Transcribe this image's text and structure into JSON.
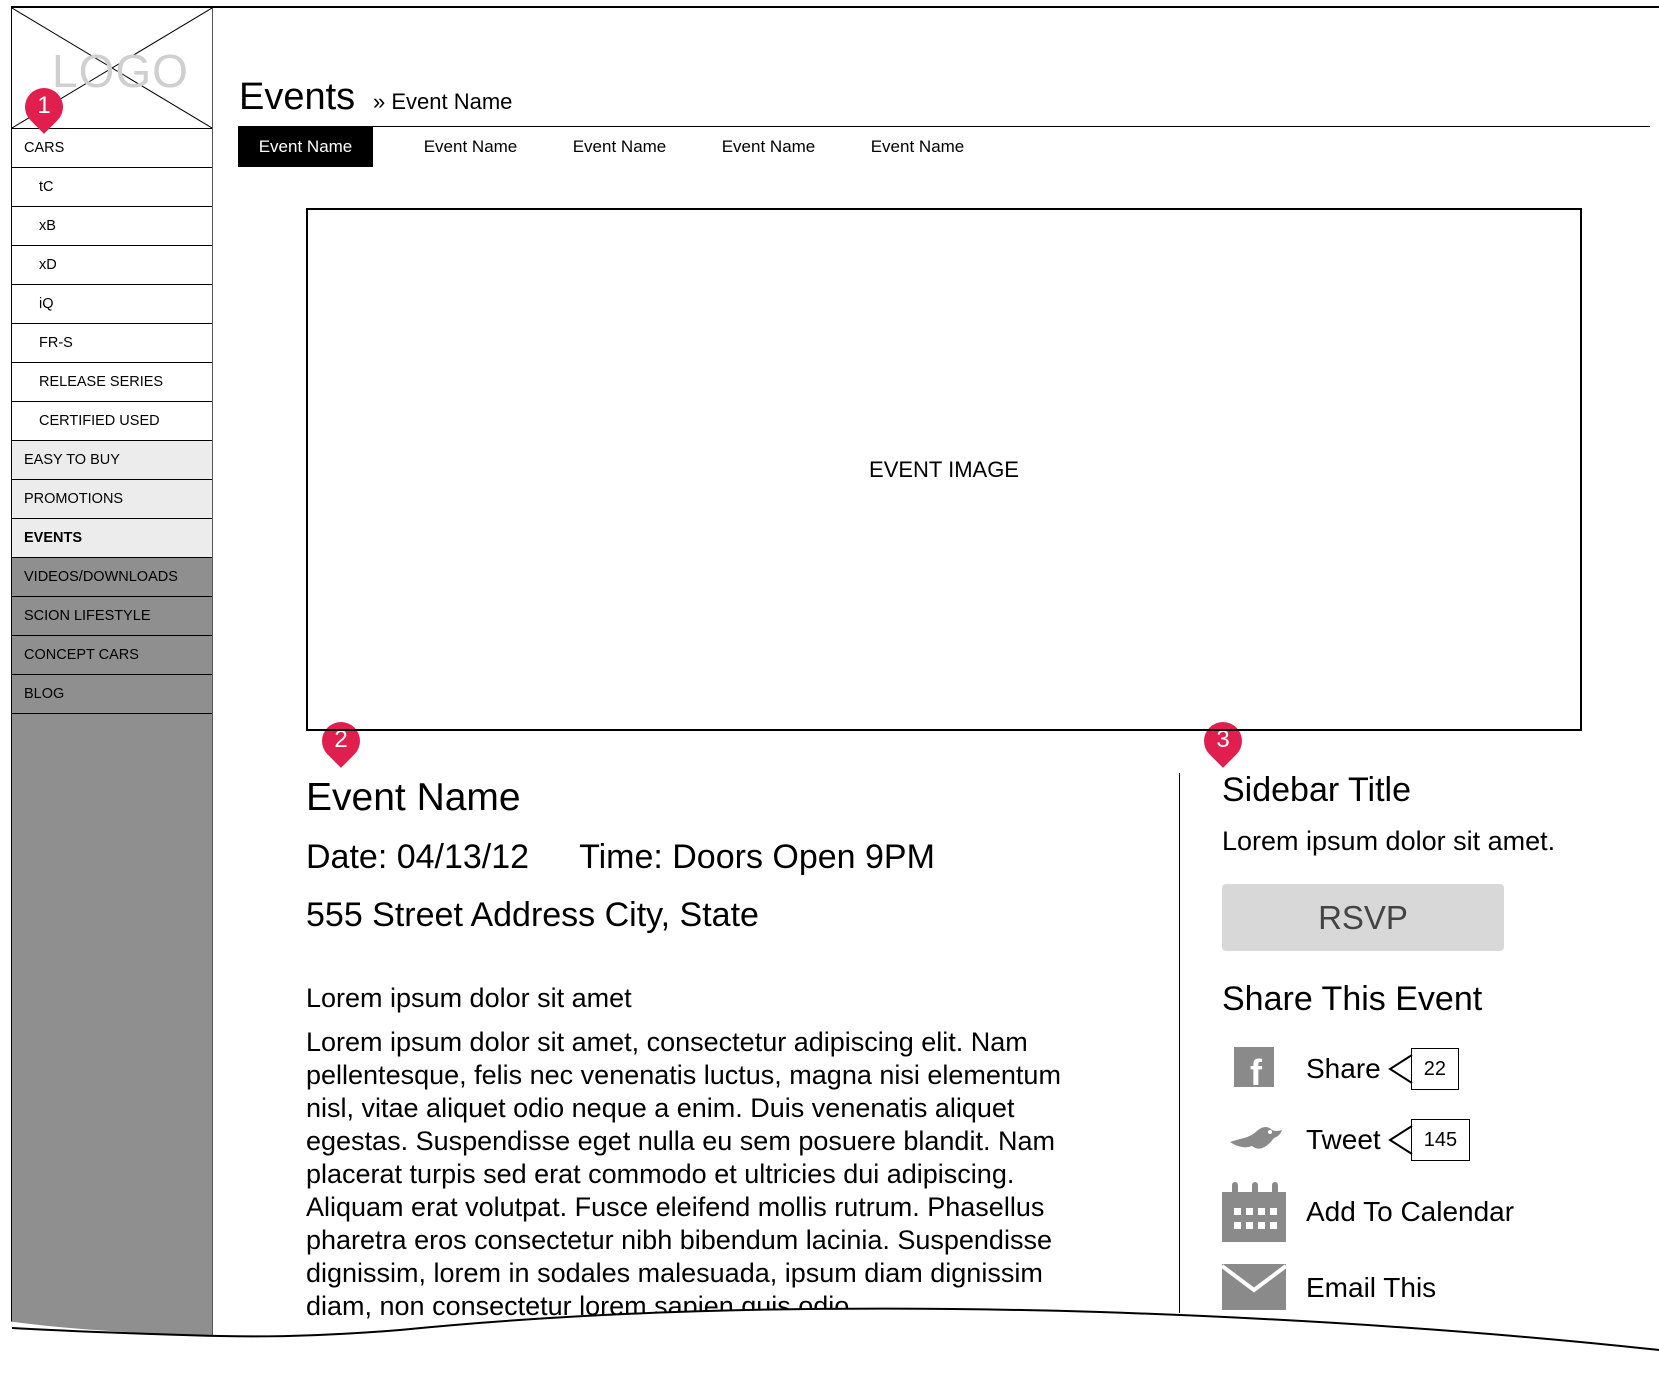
{
  "sidebar": {
    "logo_text": "LOGO",
    "items": [
      {
        "label": "CARS",
        "style": "white",
        "indent": "top"
      },
      {
        "label": "tC",
        "style": "white",
        "indent": "sub"
      },
      {
        "label": "xB",
        "style": "white",
        "indent": "sub"
      },
      {
        "label": "xD",
        "style": "white",
        "indent": "sub"
      },
      {
        "label": "iQ",
        "style": "white",
        "indent": "sub"
      },
      {
        "label": "FR-S",
        "style": "white",
        "indent": "sub"
      },
      {
        "label": "RELEASE SERIES",
        "style": "white",
        "indent": "sub"
      },
      {
        "label": "CERTIFIED USED",
        "style": "white",
        "indent": "sub"
      },
      {
        "label": "EASY TO BUY",
        "style": "light",
        "indent": "top"
      },
      {
        "label": "PROMOTIONS",
        "style": "light",
        "indent": "top"
      },
      {
        "label": "EVENTS",
        "style": "light",
        "indent": "top",
        "active": true
      },
      {
        "label": "VIDEOS/DOWNLOADS",
        "style": "dark",
        "indent": "top"
      },
      {
        "label": "SCION LIFESTYLE",
        "style": "dark",
        "indent": "top"
      },
      {
        "label": "CONCEPT CARS",
        "style": "dark",
        "indent": "top"
      },
      {
        "label": "BLOG",
        "style": "dark",
        "indent": "top"
      }
    ]
  },
  "markers": [
    "1",
    "2",
    "3"
  ],
  "header": {
    "title": "Events",
    "breadcrumb": "» Event Name"
  },
  "tabs": [
    "Event Name",
    "Event Name",
    "Event Name",
    "Event Name",
    "Event Name"
  ],
  "event_image_label": "EVENT IMAGE",
  "event": {
    "name": "Event Name",
    "date": "Date: 04/13/12",
    "time": "Time: Doors Open 9PM",
    "address": "555 Street Address City, State",
    "lead": "Lorem ipsum dolor sit amet",
    "body": "Lorem ipsum dolor sit amet, consectetur adipiscing elit. Nam pellentesque, felis nec venenatis luctus, magna nisi elementum nisl, vitae aliquet odio neque a enim. Duis venenatis aliquet egestas. Suspendisse eget nulla eu sem posuere blandit. Nam placerat turpis sed erat commodo et ultricies dui adipiscing. Aliquam erat volutpat. Fusce eleifend mollis rutrum. Phasellus pharetra eros consectetur nibh bibendum lacinia. Suspendisse dignissim, lorem in sodales malesuada, ipsum diam dignissim diam, non consectetur lorem sapien quis odio."
  },
  "side": {
    "title": "Sidebar Title",
    "desc": "Lorem ipsum dolor sit amet.",
    "rsvp": "RSVP",
    "share_title": "Share This Event",
    "share": {
      "label": "Share",
      "count": "22",
      "icon": "facebook-icon"
    },
    "tweet": {
      "label": "Tweet",
      "count": "145",
      "icon": "twitter-bird-icon"
    },
    "calendar": {
      "label": "Add To Calendar",
      "icon": "calendar-icon"
    },
    "email": {
      "label": "Email This",
      "icon": "envelope-icon"
    }
  }
}
